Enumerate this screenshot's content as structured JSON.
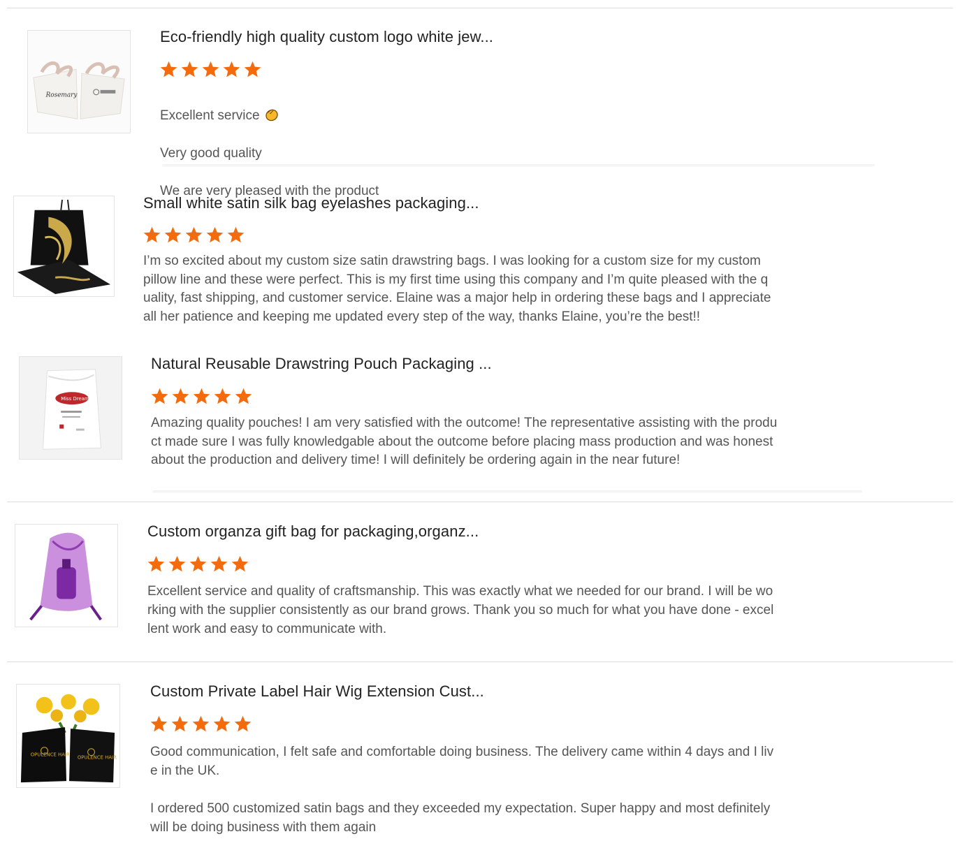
{
  "colors": {
    "star": "#f36b0c",
    "text": "#555555",
    "title": "#222222",
    "divider": "#dcdcdc"
  },
  "reviews": [
    {
      "image_icon": "white-jewelry-pouch-image",
      "title": "Eco-friendly high quality custom logo white jew...",
      "rating": 5,
      "lines": [
        "Excellent service",
        "Very good quality",
        "We are very pleased with the product"
      ],
      "emoji_icon": "clapping-hands-icon"
    },
    {
      "image_icon": "black-satin-bag-image",
      "title": "Small white satin silk bag eyelashes packaging...",
      "rating": 5,
      "text": "I’m so excited about my custom size satin drawstring bags. I was looking for a custom size for my custom\npillow line and these were perfect. This is my first time using this company and I’m quite pleased with the q\nuality, fast shipping, and customer service. Elaine was a major help in ordering these bags and I appreciate\nall her patience and keeping me updated every step of the way, thanks Elaine, you’re the best!!"
    },
    {
      "image_icon": "white-drawstring-pouch-image",
      "title": "Natural Reusable Drawstring Pouch Packaging ...",
      "rating": 5,
      "text": "Amazing quality pouches! I am very satisfied with the outcome! The representative assisting with the produ\nct made sure I was fully knowledgable about the outcome before placing mass production and was honest\nabout the production and delivery time! I will definitely be ordering again in the near future!"
    },
    {
      "image_icon": "purple-organza-bag-image",
      "title": "Custom organza gift bag for packaging,organz...",
      "rating": 5,
      "text": "Excellent service and quality of craftsmanship. This was exactly what we needed for our brand. I will be wo\nrking with the supplier consistently as our brand  grows. Thank you so much for what you have done - excel\nlent work and easy to communicate with."
    },
    {
      "image_icon": "black-satin-hair-bags-image",
      "title": "Custom Private Label Hair Wig Extension Cust...",
      "rating": 5,
      "text": "Good communication, I felt safe and comfortable doing business. The delivery came within 4 days and I liv\ne in the UK.\n\nI ordered 500 customized satin bags and they exceeded my expectation.  Super happy and most definitely\nwill be doing business with them again"
    }
  ]
}
